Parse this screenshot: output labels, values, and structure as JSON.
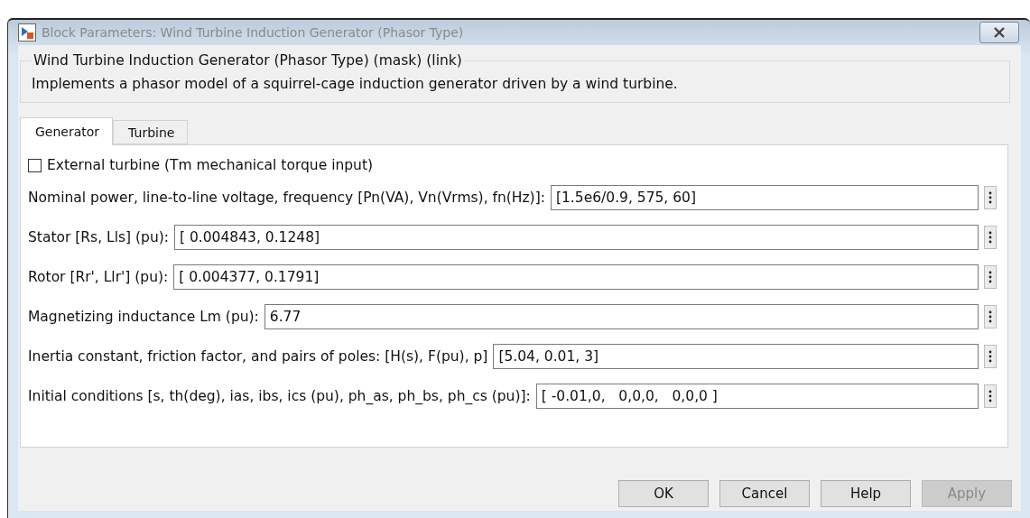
{
  "window": {
    "title": "Block Parameters: Wind Turbine Induction Generator (Phasor Type)",
    "active": false
  },
  "group": {
    "title": "Wind Turbine Induction Generator (Phasor Type) (mask) (link)",
    "description": "Implements a phasor model of a squirrel-cage induction generator driven by a wind turbine."
  },
  "tabs": [
    {
      "label": "Generator",
      "selected": true
    },
    {
      "label": "Turbine",
      "selected": false
    }
  ],
  "checkbox": {
    "label": "External turbine (Tm mechanical torque input)",
    "checked": false
  },
  "parameters": [
    {
      "label": "Nominal power, line-to-line voltage, frequency [Pn(VA), Vn(Vrms), fn(Hz)]:",
      "value": "[1.5e6/0.9, 575, 60]"
    },
    {
      "label": "Stator [Rs, Lls] (pu):",
      "value": "[ 0.004843, 0.1248]"
    },
    {
      "label": "Rotor [Rr', Llr'] (pu):",
      "value": "[ 0.004377, 0.1791]"
    },
    {
      "label": "Magnetizing inductance Lm (pu):",
      "value": "6.77"
    },
    {
      "label": "Inertia constant, friction factor, and pairs of poles: [H(s), F(pu), p]",
      "value": "[5.04, 0.01, 3]"
    },
    {
      "label": "Initial conditions [s, th(deg), ias, ibs, ics (pu), ph_as, ph_bs, ph_cs (pu)]:",
      "value": "[ -0.01,0,   0,0,0,   0,0,0 ]"
    }
  ],
  "buttons": [
    {
      "label": "OK",
      "disabled": false
    },
    {
      "label": "Cancel",
      "disabled": false
    },
    {
      "label": "Help",
      "disabled": false
    },
    {
      "label": "Apply",
      "disabled": true
    }
  ]
}
